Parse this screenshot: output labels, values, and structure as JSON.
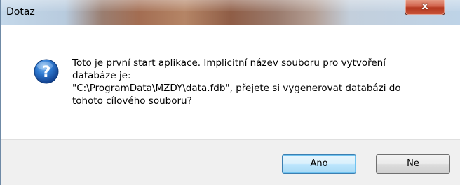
{
  "window": {
    "title": "Dotaz",
    "close_label": "x"
  },
  "icon": {
    "name": "question-icon",
    "glyph": "?",
    "color": "#1a5fb4"
  },
  "message": {
    "text": "Toto je první start aplikace. Implicitní název souboru pro vytvoření\ndatabáze je:\n\"C:\\ProgramData\\MZDY\\data.fdb\", přejete si vygenerovat databázi do\ntohoto cílového souboru?"
  },
  "buttons": {
    "yes_label": "Ano",
    "no_label": "Ne"
  }
}
